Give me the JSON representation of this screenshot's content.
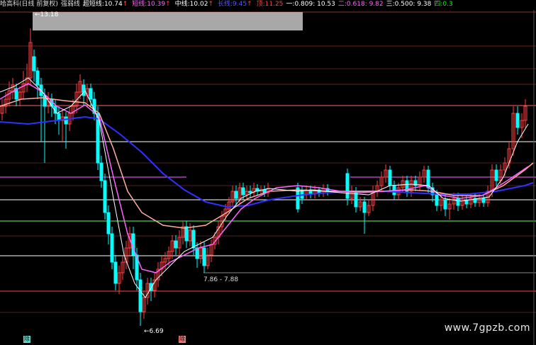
{
  "legend": [
    {
      "label": "哈高科(日线 前复权)",
      "value": "",
      "color": "#dcdcdc",
      "arrow": ""
    },
    {
      "label": "强弱线",
      "value": "",
      "color": "#dcdcdc",
      "arrow": ""
    },
    {
      "label": "超短线:",
      "value": "10.74",
      "color": "#ffffff",
      "arrow": "↑"
    },
    {
      "label": "短线:",
      "value": "10.39",
      "color": "#ff66ff",
      "arrow": "↑"
    },
    {
      "label": "中线:",
      "value": "10.02",
      "color": "#ffffff",
      "arrow": "↑"
    },
    {
      "label": "长线:",
      "value": "9.45",
      "color": "#5555ff",
      "arrow": "↑"
    },
    {
      "label": "顶:",
      "value": "11.25",
      "color": "#ff4444",
      "arrow": ""
    },
    {
      "label": "一:",
      "value": "0.809: 10.53",
      "color": "#ffffff",
      "arrow": ""
    },
    {
      "label": "二:",
      "value": "0.618: 9.82",
      "color": "#ff66ff",
      "arrow": ""
    },
    {
      "label": "三:",
      "value": "0.500: 9.38",
      "color": "#ffffff",
      "arrow": ""
    },
    {
      "label": "四:",
      "value": "0.3",
      "color": "#00ff00",
      "arrow": ""
    }
  ],
  "annotations": {
    "high": "13.18",
    "low": "6.69",
    "mid": "7.86 - 7.88"
  },
  "watermark": "www.7gpzb.com",
  "bottom_tags": [
    {
      "label": "除",
      "color": "#66ddcc"
    },
    {
      "label": "除",
      "color": "#ff7777"
    }
  ],
  "colors": {
    "up_candle": "#ff4040",
    "down_candle": "#00ffff",
    "ma_short": "#ff66ff",
    "ma_ultra": "#ffffff",
    "ma_mid": "#ffb0a0",
    "ma_long": "#3030ff"
  }
}
